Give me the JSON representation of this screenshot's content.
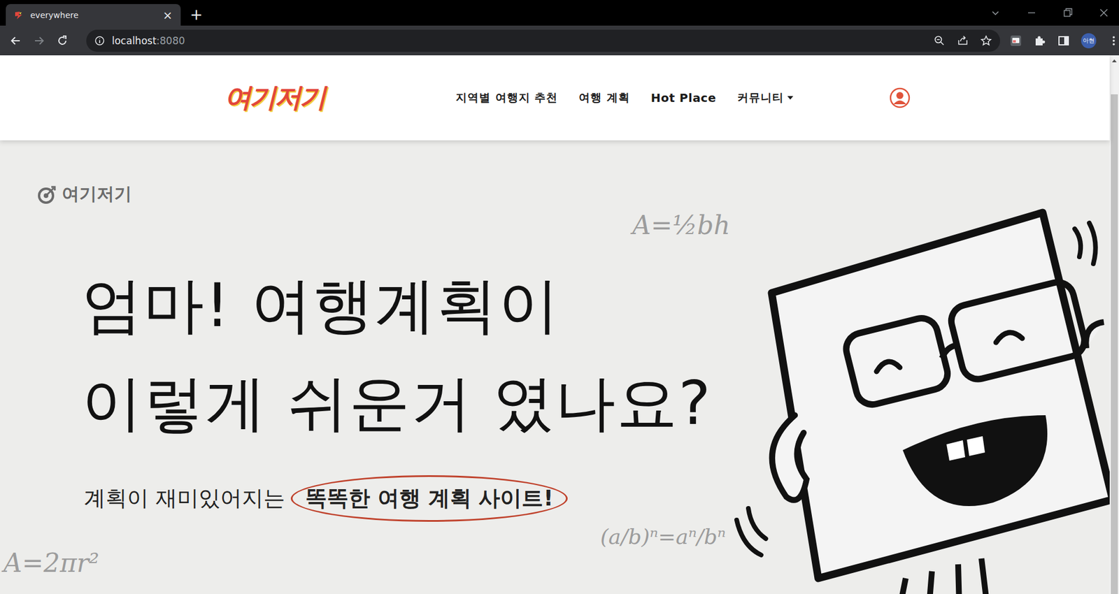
{
  "window": {
    "title": "everywhere",
    "tab_close": "×",
    "new_tab": "+"
  },
  "address_bar": {
    "host": "localhost",
    "port": ":8080"
  },
  "profile": {
    "initials": "아현"
  },
  "site": {
    "logo": "여기저기",
    "nav": [
      {
        "label": "지역별 여행지 추천",
        "dropdown": false,
        "latin": false
      },
      {
        "label": "여행 계획",
        "dropdown": false,
        "latin": false
      },
      {
        "label": "Hot Place",
        "dropdown": false,
        "latin": true
      },
      {
        "label": "커뮤니티",
        "dropdown": true,
        "latin": false
      }
    ]
  },
  "hero": {
    "brand": "여기저기",
    "headline": [
      "엄마! 여행계획이",
      "이렇게 쉬운거 였나요?"
    ],
    "subtitle": "계획이 재미있어지는",
    "highlight": "똑똑한 여행 계획 사이트!",
    "formulas": [
      "A=½bh",
      "(a/b)ⁿ=aⁿ/bⁿ",
      "A=2πr²"
    ]
  },
  "scrollbar": {
    "offset": 0.055,
    "level": 0.945
  }
}
